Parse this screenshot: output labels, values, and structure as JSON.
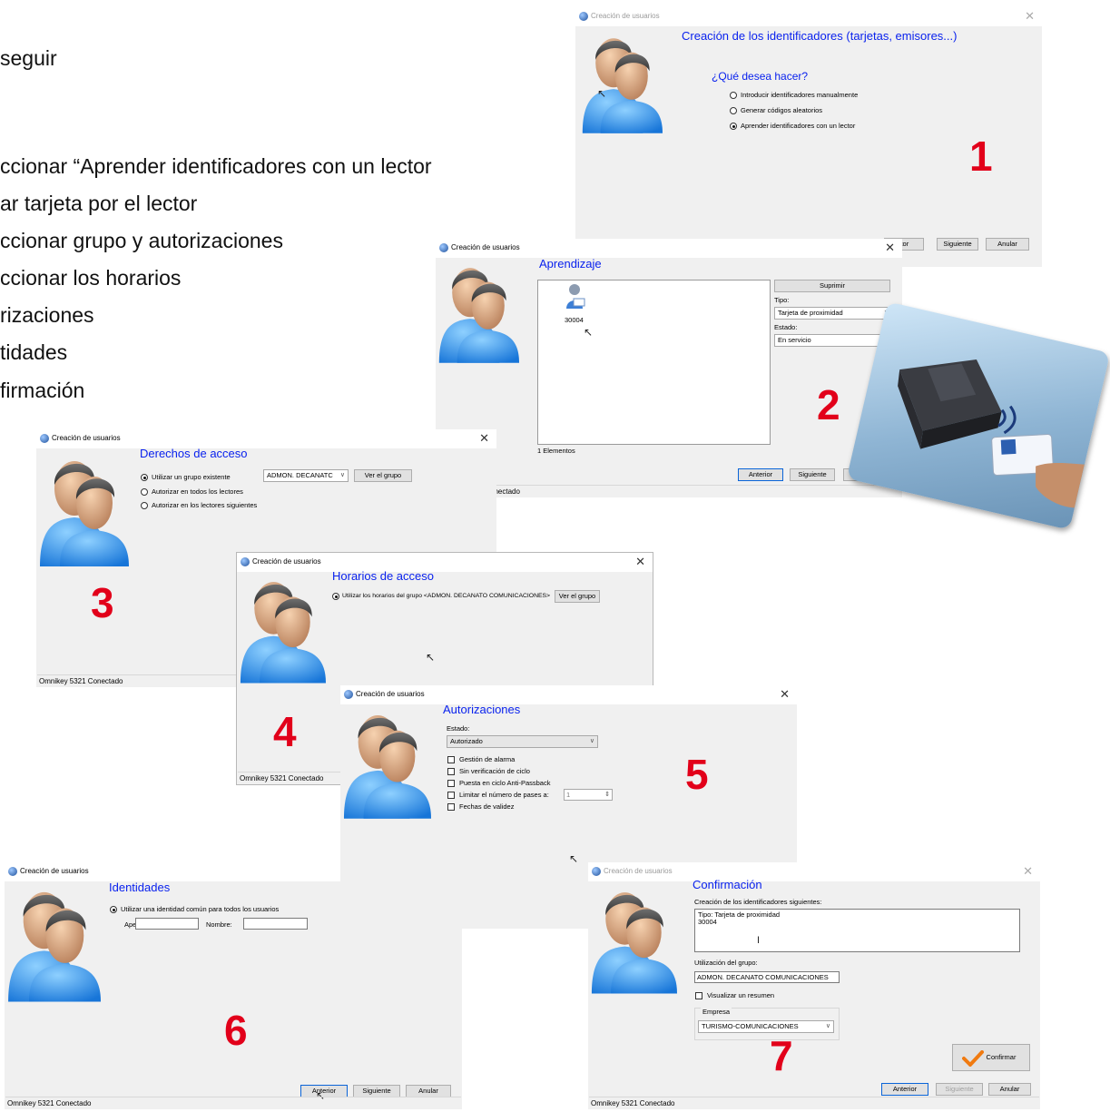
{
  "bullets": [
    "seguir",
    "ccionar “Aprender identificadores con un lector",
    "ar tarjeta por el lector",
    "ccionar grupo y autorizaciones",
    "ccionar los horarios",
    "rizaciones",
    "tidades",
    "firmación"
  ],
  "window_title": "Creación de usuarios",
  "status_text": "Omnikey 5321 Conectado",
  "buttons": {
    "prev": "Anterior",
    "next": "Siguiente",
    "cancel": "Anular"
  },
  "colors": {
    "heading": "#0a22ee",
    "step_number": "#e2001a"
  },
  "w1": {
    "heading": "Creación de los identificadores (tarjetas, emisores...)",
    "question": "¿Qué desea hacer?",
    "options": [
      "Introducir identificadores manualmente",
      "Generar códigos aleatorios",
      "Aprender identificadores con un lector"
    ],
    "selected": 2,
    "step": "1",
    "prev_partial": "itor"
  },
  "w2": {
    "heading": "Aprendizaje",
    "card_id": "30004",
    "count_text": "1 Elementos",
    "delete_label": "Suprimir",
    "tipo_label": "Tipo:",
    "tipo_value": "Tarjeta de proximidad",
    "estado_label": "Estado:",
    "estado_value": "En servicio",
    "status_partial": "onectado",
    "cancel_partial": "Anul",
    "step": "2"
  },
  "w3": {
    "heading": "Derechos de acceso",
    "options": [
      "Utilizar un grupo existente",
      "Autorizar en todos los lectores",
      "Autorizar en los lectores siguientes"
    ],
    "group_value": "ADMON. DECANATC",
    "view_group": "Ver el grupo",
    "step": "3"
  },
  "w4": {
    "heading": "Horarios de acceso",
    "option": "Utilizar los horarios del grupo <ADMON. DECANATO COMUNICACIONES>",
    "view_group": "Ver el grupo",
    "step": "4"
  },
  "w5": {
    "heading": "Autorizaciones",
    "estado_label": "Estado:",
    "estado_value": "Autorizado",
    "checks": [
      "Gestión de alarma",
      "Sin verificación de ciclo",
      "Puesta en ciclo Anti-Passback",
      "Limitar el número de pases a:",
      "Fechas de validez"
    ],
    "passes_value": "1",
    "step": "5"
  },
  "w6": {
    "heading": "Identidades",
    "option": "Utilizar una identidad común para todos los usuarios",
    "apellido_label": "Apellido:",
    "nombre_label": "Nombre:",
    "step": "6"
  },
  "w7": {
    "heading": "Confirmación",
    "creation_label": "Creación de los identificadores siguientes:",
    "creation_text": "Tipo: Tarjeta de proximidad\n30004",
    "group_label": "Utilización del grupo:",
    "group_value": "ADMON. DECANATO COMUNICACIONES",
    "summary_label": "Visualizar un resumen",
    "empresa_label": "Empresa",
    "empresa_value": "TURISMO-COMUNICACIONES",
    "confirm_label": "Confirmar",
    "step": "7"
  }
}
